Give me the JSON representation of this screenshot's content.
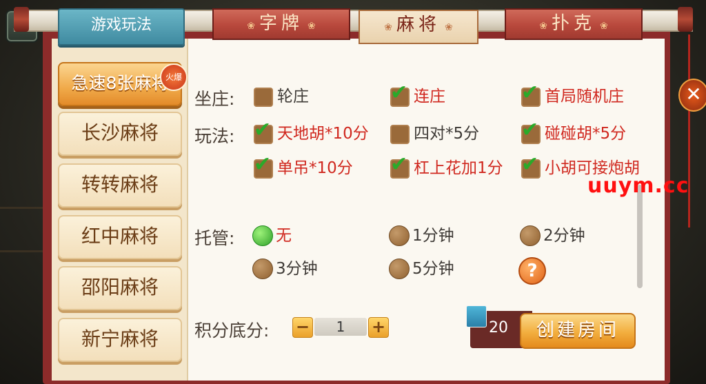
{
  "tabs": {
    "title": "游戏玩法",
    "items": [
      {
        "label": "字牌",
        "active": false
      },
      {
        "label": "麻将",
        "active": true
      },
      {
        "label": "扑克",
        "active": false
      }
    ],
    "ornament": "❀"
  },
  "games": [
    {
      "label": "急速8张麻将",
      "active": true
    },
    {
      "label": "长沙麻将",
      "active": false
    },
    {
      "label": "转转麻将",
      "active": false
    },
    {
      "label": "红中麻将",
      "active": false
    },
    {
      "label": "邵阳麻将",
      "active": false
    },
    {
      "label": "新宁麻将",
      "active": false
    }
  ],
  "hot_badge": "火爆",
  "options": {
    "zuozhuang_label": "坐庄:",
    "zuozhuang": [
      {
        "label": "轮庄",
        "checked": false
      },
      {
        "label": "连庄",
        "checked": true
      },
      {
        "label": "首局随机庄",
        "checked": true
      }
    ],
    "wanfa_label": "玩法:",
    "wanfa": [
      {
        "label": "天地胡*10分",
        "checked": true
      },
      {
        "label": "四对*5分",
        "checked": false
      },
      {
        "label": "碰碰胡*5分",
        "checked": true
      },
      {
        "label": "单吊*10分",
        "checked": true
      },
      {
        "label": "杠上花加1分",
        "checked": true
      },
      {
        "label": "小胡可接炮胡",
        "checked": true
      }
    ],
    "tuoguan_label": "托管:",
    "tuoguan": [
      {
        "label": "无",
        "selected": true
      },
      {
        "label": "1分钟",
        "selected": false
      },
      {
        "label": "2分钟",
        "selected": false
      },
      {
        "label": "3分钟",
        "selected": false
      },
      {
        "label": "5分钟",
        "selected": false
      }
    ],
    "help": "?"
  },
  "score": {
    "label": "积分底分:",
    "minus": "−",
    "value": "1",
    "plus": "+"
  },
  "create": {
    "cost": "20",
    "label": "创建房间"
  },
  "close": "✕",
  "watermark": "uuym.cc",
  "colors": {
    "accent_red": "#8c2b2a",
    "check_green": "#2aaa2a",
    "selected_text": "#d0281f",
    "button_orange": "#f2ae3e"
  }
}
